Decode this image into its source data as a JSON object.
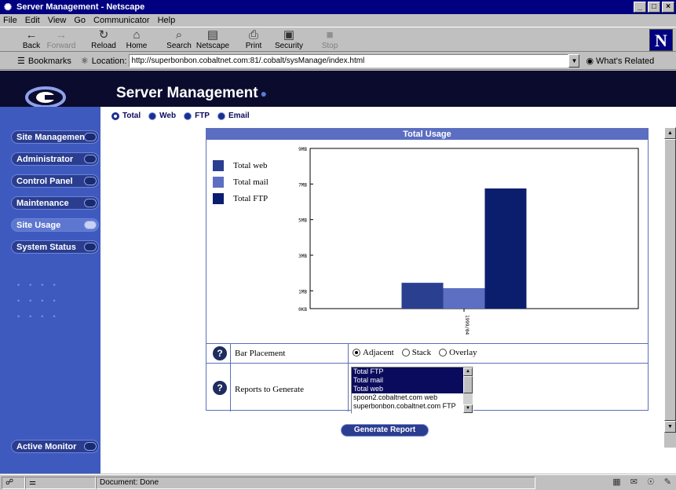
{
  "window": {
    "title": "Server Management - Netscape",
    "controls": [
      "_",
      "□",
      "×"
    ]
  },
  "menu": [
    "File",
    "Edit",
    "View",
    "Go",
    "Communicator",
    "Help"
  ],
  "toolbar": [
    {
      "label": "Back",
      "icon": "back-icon",
      "glyph": "←",
      "enabled": true
    },
    {
      "label": "Forward",
      "icon": "forward-icon",
      "glyph": "→",
      "enabled": false
    },
    {
      "label": "Reload",
      "icon": "reload-icon",
      "glyph": "↻",
      "enabled": true
    },
    {
      "label": "Home",
      "icon": "home-icon",
      "glyph": "⌂",
      "enabled": true
    },
    {
      "label": "Search",
      "icon": "search-icon",
      "glyph": "⌕",
      "enabled": true
    },
    {
      "label": "Netscape",
      "icon": "netscape-icon",
      "glyph": "▤",
      "enabled": true
    },
    {
      "label": "Print",
      "icon": "print-icon",
      "glyph": "⎙",
      "enabled": true
    },
    {
      "label": "Security",
      "icon": "security-icon",
      "glyph": "▣",
      "enabled": true
    },
    {
      "label": "Stop",
      "icon": "stop-icon",
      "glyph": "■",
      "enabled": false
    }
  ],
  "location": {
    "bookmarks_label": "Bookmarks",
    "location_label": "Location:",
    "url": "http://superbonbon.cobaltnet.com:81/.cobalt/sysManage/index.html",
    "related_label": "What's Related"
  },
  "page": {
    "title": "Server Management",
    "subnav": [
      {
        "label": "Total",
        "active": true
      },
      {
        "label": "Web",
        "active": false
      },
      {
        "label": "FTP",
        "active": false
      },
      {
        "label": "Email",
        "active": false
      }
    ],
    "sidebar": [
      {
        "label": "Site Management",
        "active": false
      },
      {
        "label": "Administrator",
        "active": false
      },
      {
        "label": "Control Panel",
        "active": false
      },
      {
        "label": "Maintenance",
        "active": false
      },
      {
        "label": "Site Usage",
        "active": true
      },
      {
        "label": "System Status",
        "active": false
      }
    ],
    "sidebar_bottom": "Active Monitor",
    "panel_title": "Total Usage",
    "bar_placement": {
      "label": "Bar Placement",
      "options": [
        {
          "label": "Adjacent",
          "checked": true
        },
        {
          "label": "Stack",
          "checked": false
        },
        {
          "label": "Overlay",
          "checked": false
        }
      ]
    },
    "reports": {
      "label": "Reports to Generate",
      "items": [
        {
          "label": "Total FTP",
          "selected": true
        },
        {
          "label": "Total mail",
          "selected": true
        },
        {
          "label": "Total web",
          "selected": true
        },
        {
          "label": "spoon2.cobaltnet.com web",
          "selected": false
        },
        {
          "label": "superbonbon.cobaltnet.com FTP",
          "selected": false
        }
      ]
    },
    "generate_label": "Generate Report"
  },
  "chart_data": {
    "type": "bar",
    "title": "Total Usage",
    "categories": [
      "1999/04"
    ],
    "yticks": [
      "0KB",
      "1MB",
      "3MB",
      "5MB",
      "7MB",
      "9MB"
    ],
    "ytick_values": [
      0,
      1,
      3,
      5,
      7,
      9
    ],
    "ylim": [
      0,
      9
    ],
    "series": [
      {
        "name": "Total web",
        "values": [
          1.45
        ],
        "color": "#2a3f8f"
      },
      {
        "name": "Total mail",
        "values": [
          1.15
        ],
        "color": "#5c6fc2"
      },
      {
        "name": "Total FTP",
        "values": [
          6.75
        ],
        "color": "#0b1e6e"
      }
    ]
  },
  "status": {
    "text": "Document: Done"
  }
}
